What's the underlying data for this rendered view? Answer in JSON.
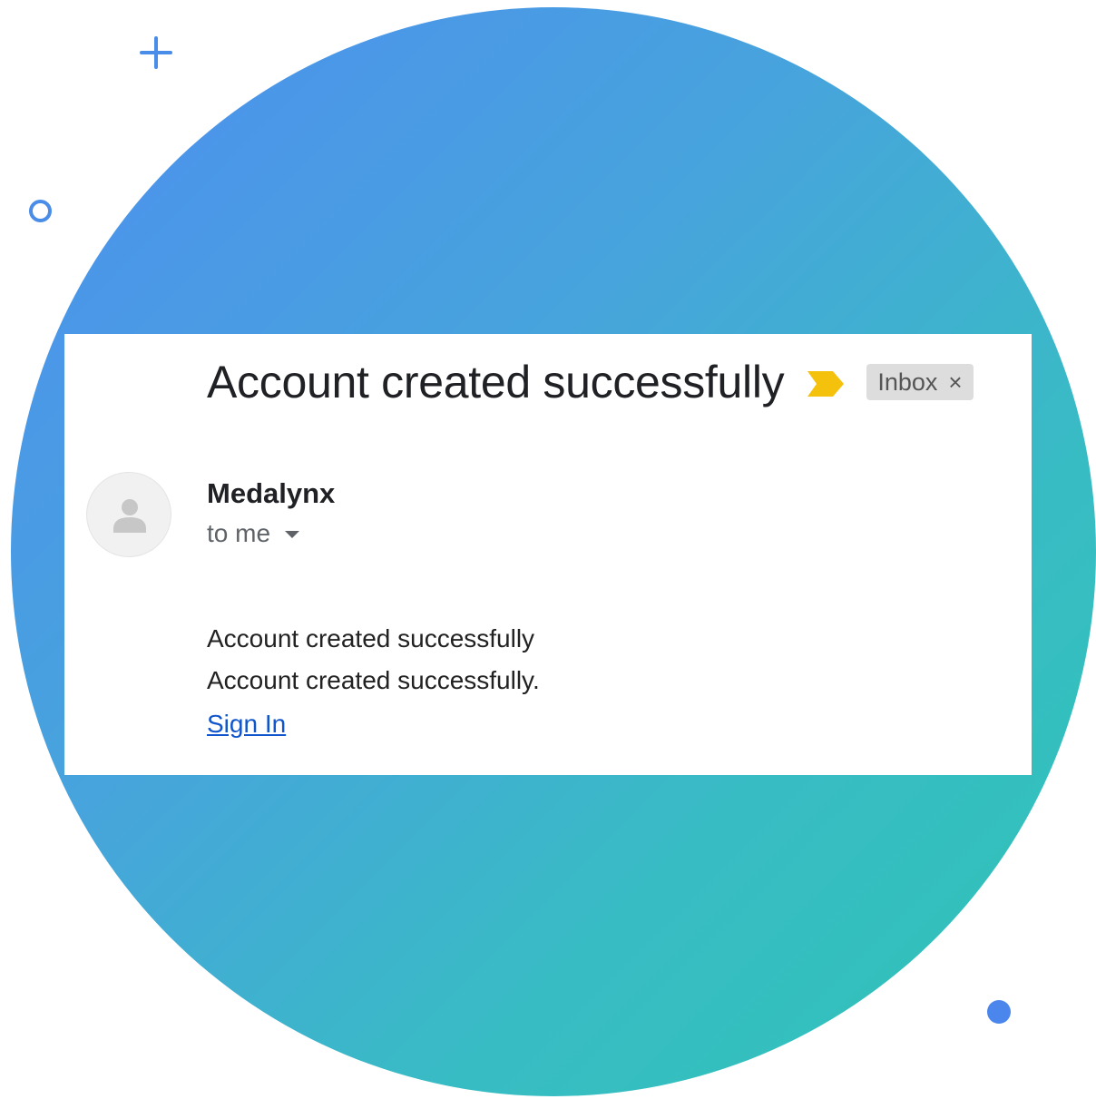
{
  "email": {
    "subject": "Account created successfully",
    "label_chip": "Inbox",
    "label_chip_close": "×",
    "sender": "Medalynx",
    "recipient": "to me",
    "body_lines": [
      "Account created successfully",
      "Account created successfully."
    ],
    "link_text": "Sign In"
  },
  "icons": {
    "importance": "importance-marker-icon",
    "avatar": "default-person-avatar-icon",
    "recipient_toggle": "caret-down-icon",
    "decorations": [
      "plus-icon",
      "ring-icon",
      "dot-icon"
    ]
  },
  "colors": {
    "gradient_start": "#4d8ef0",
    "gradient_end": "#2ec4b6",
    "importance_marker": "#f4c20d",
    "link": "#1155cc",
    "chip_bg": "#dddddd",
    "decoration": "#4a8de8"
  }
}
